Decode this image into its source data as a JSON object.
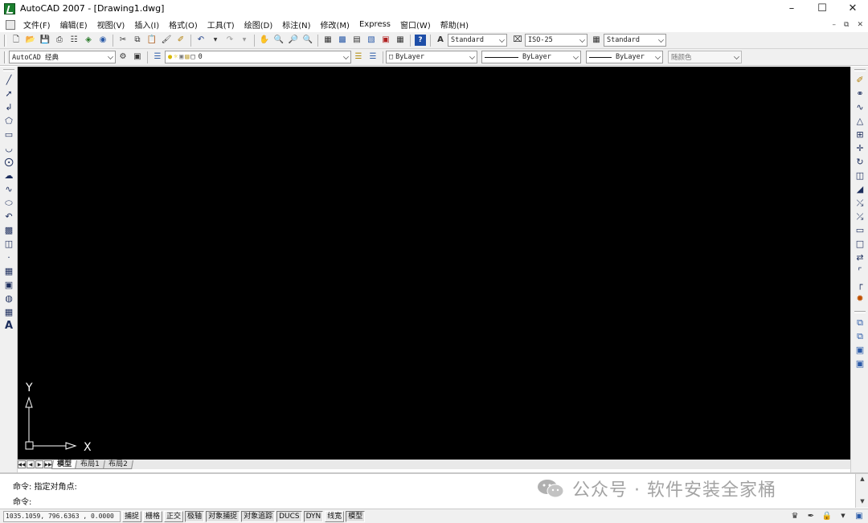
{
  "window": {
    "title": "AutoCAD 2007 - [Drawing1.dwg]"
  },
  "menu": {
    "items": [
      {
        "label": "文件(F)"
      },
      {
        "label": "编辑(E)"
      },
      {
        "label": "视图(V)"
      },
      {
        "label": "插入(I)"
      },
      {
        "label": "格式(O)"
      },
      {
        "label": "工具(T)"
      },
      {
        "label": "绘图(D)"
      },
      {
        "label": "标注(N)"
      },
      {
        "label": "修改(M)"
      },
      {
        "label": "Express"
      },
      {
        "label": "窗口(W)"
      },
      {
        "label": "帮助(H)"
      }
    ]
  },
  "toolbar": {
    "text_style": "Standard",
    "dim_style": "ISO-25",
    "table_style": "Standard",
    "workspace": "AutoCAD 经典",
    "layer": "0",
    "color": "ByLayer",
    "linetype": "ByLayer",
    "lineweight": "ByLayer",
    "plot_style": "随颜色"
  },
  "canvas": {
    "background": "#000000",
    "ucs_x_label": "X",
    "ucs_y_label": "Y"
  },
  "tabs": [
    {
      "label": "模型"
    },
    {
      "label": "布局1"
    },
    {
      "label": "布局2"
    }
  ],
  "command": {
    "history_line": "命令: 指定对角点:",
    "prompt_line": "命令:"
  },
  "watermark": {
    "text": "公众号 · 软件安装全家桶"
  },
  "status": {
    "coords": "1035.1059, 796.6363 , 0.0000",
    "buttons": [
      {
        "label": "捕捉",
        "on": false
      },
      {
        "label": "栅格",
        "on": false
      },
      {
        "label": "正交",
        "on": false
      },
      {
        "label": "极轴",
        "on": true
      },
      {
        "label": "对象捕捉",
        "on": true
      },
      {
        "label": "对象追踪",
        "on": true
      },
      {
        "label": "DUCS",
        "on": true
      },
      {
        "label": "DYN",
        "on": true
      },
      {
        "label": "线宽",
        "on": false
      },
      {
        "label": "模型",
        "on": true
      }
    ]
  }
}
